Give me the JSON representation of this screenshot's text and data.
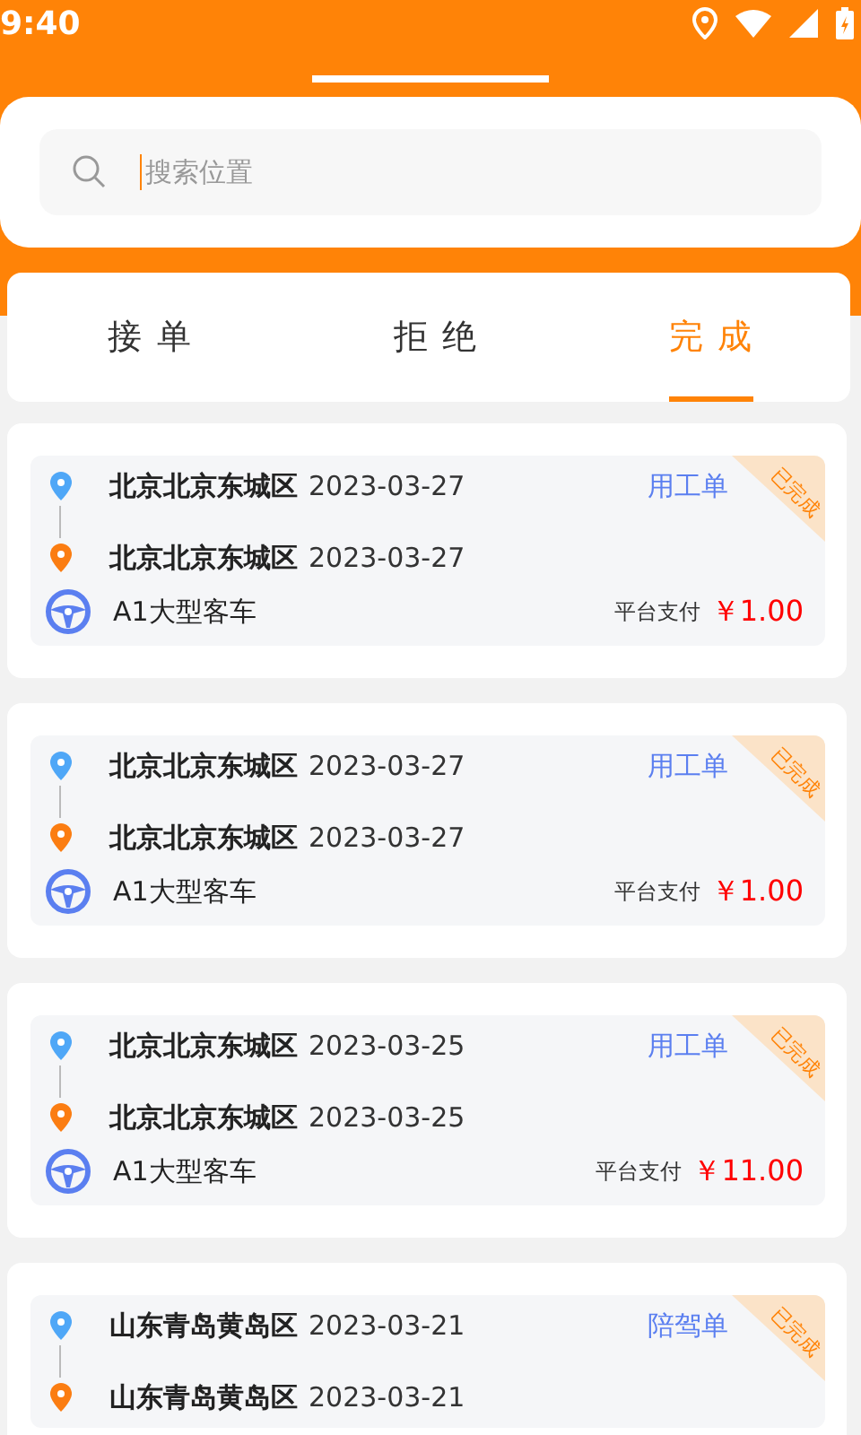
{
  "status_bar": {
    "time": "9:40"
  },
  "search": {
    "placeholder": "搜索位置"
  },
  "tabs": [
    {
      "label": "接 单",
      "selected": false
    },
    {
      "label": "拒 绝",
      "selected": false
    },
    {
      "label": "完 成",
      "selected": true
    }
  ],
  "orders": [
    {
      "from": "北京北京东城区",
      "from_date": "2023-03-27",
      "to": "北京北京东城区",
      "to_date": "2023-03-27",
      "type": "用工单",
      "badge": "已完成",
      "vehicle": "A1大型客车",
      "payment": "平台支付",
      "price": "￥1.00"
    },
    {
      "from": "北京北京东城区",
      "from_date": "2023-03-27",
      "to": "北京北京东城区",
      "to_date": "2023-03-27",
      "type": "用工单",
      "badge": "已完成",
      "vehicle": "A1大型客车",
      "payment": "平台支付",
      "price": "￥1.00"
    },
    {
      "from": "北京北京东城区",
      "from_date": "2023-03-25",
      "to": "北京北京东城区",
      "to_date": "2023-03-25",
      "type": "用工单",
      "badge": "已完成",
      "vehicle": "A1大型客车",
      "payment": "平台支付",
      "price": "￥11.00"
    },
    {
      "from": "山东青岛黄岛区",
      "from_date": "2023-03-21",
      "to": "山东青岛黄岛区",
      "to_date": "2023-03-21",
      "type": "陪驾单",
      "badge": "已完成"
    }
  ]
}
